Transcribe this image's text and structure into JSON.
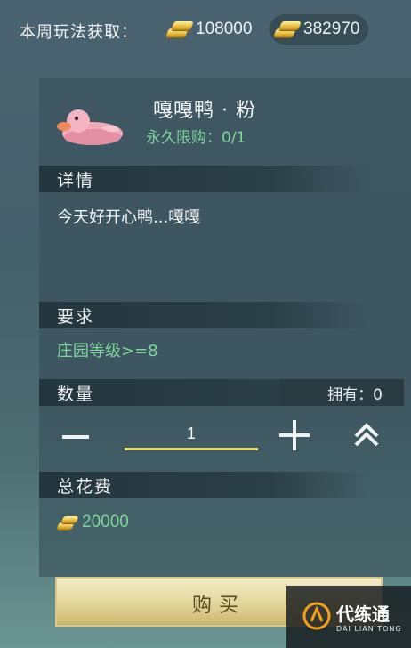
{
  "topbar": {
    "label": "本周玩法获取：",
    "currency1": {
      "icon": "gold-ingot-icon",
      "value": "108000"
    },
    "currency2": {
      "icon": "gold-ingot-icon",
      "value": "382970"
    }
  },
  "item": {
    "name": "嘎嘎鸭 · 粉",
    "limit": "永久限购：0/1",
    "icon": "pink-duck-icon"
  },
  "details": {
    "title": "详情",
    "text": "今天好开心鸭...嘎嘎"
  },
  "requirement": {
    "title": "要求",
    "text": "庄园等级>=8"
  },
  "quantity": {
    "title": "数量",
    "owned": "拥有：0",
    "value": "1"
  },
  "total": {
    "title": "总花费",
    "value": "20000",
    "icon": "gold-ingot-icon"
  },
  "buy": {
    "label": "购买"
  },
  "watermark": {
    "cn": "代练通",
    "en": "DAI LIAN TONG"
  },
  "colors": {
    "accent_green": "#7fd69a",
    "gold": "#e6b93a",
    "underline": "#e5d86a"
  }
}
